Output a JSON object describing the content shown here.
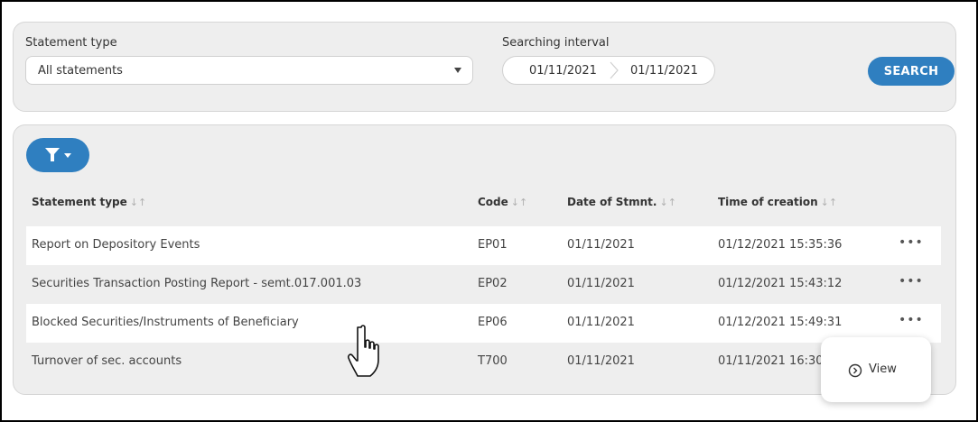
{
  "filters": {
    "statement_type_label": "Statement type",
    "statement_type_value": "All statements",
    "interval_label": "Searching interval",
    "date_from": "01/11/2021",
    "date_to": "01/11/2021",
    "search_label": "SEARCH"
  },
  "table": {
    "headers": {
      "statement_type": "Statement type",
      "code": "Code",
      "date": "Date of Stmnt.",
      "time": "Time of creation"
    },
    "rows": [
      {
        "statement_type": "Report on Depository Events",
        "code": "EP01",
        "date": "01/11/2021",
        "time": "01/12/2021 15:35:36",
        "actions": "•••"
      },
      {
        "statement_type": "Securities Transaction Posting Report - semt.017.001.03",
        "code": "EP02",
        "date": "01/11/2021",
        "time": "01/12/2021 15:43:12",
        "actions": "•••"
      },
      {
        "statement_type": "Blocked Securities/Instruments of Beneficiary",
        "code": "EP06",
        "date": "01/11/2021",
        "time": "01/12/2021 15:49:31",
        "actions": "•••"
      },
      {
        "statement_type": "Turnover of sec. accounts",
        "code": "T700",
        "date": "01/11/2021",
        "time": "01/11/2021 16:30",
        "actions": ""
      }
    ]
  },
  "popup": {
    "view_label": "View"
  },
  "icons": {
    "filter": "filter-icon",
    "sort": "sort-icon",
    "view": "chevron-circle-icon",
    "cursor": "hand-pointer-icon"
  },
  "colors": {
    "accent": "#2f7fc0",
    "panel": "#eeeeee"
  }
}
